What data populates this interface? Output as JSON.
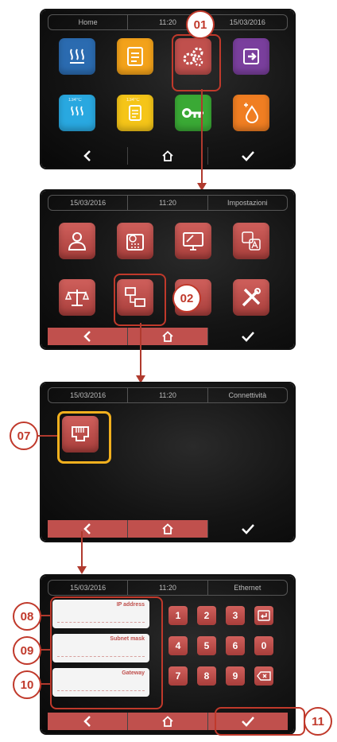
{
  "screen1": {
    "topbar": {
      "title": "Home",
      "time": "11:20",
      "date": "15/03/2016"
    },
    "tiles": [
      {
        "icon": "heating-icon",
        "color": "#2b6bb0",
        "label": ""
      },
      {
        "icon": "checklist-icon",
        "color": "#f3a21a",
        "label": ""
      },
      {
        "icon": "settings-gears-icon",
        "color": "#c0504d",
        "label": ""
      },
      {
        "icon": "exit-icon",
        "color": "#7a3f9d",
        "label": ""
      },
      {
        "icon": "sterilization-icon",
        "color": "#29a8e0",
        "label": "134°C"
      },
      {
        "icon": "program-icon",
        "color": "#f5c518",
        "label": "134°C"
      },
      {
        "icon": "key-icon",
        "color": "#3aa935",
        "label": ""
      },
      {
        "icon": "water-drop-icon",
        "color": "#f07e22",
        "label": ""
      }
    ],
    "badge": "01"
  },
  "screen2": {
    "topbar": {
      "date": "15/03/2016",
      "time": "11:20",
      "title": "Impostazioni"
    },
    "badge": "02"
  },
  "screen3": {
    "topbar": {
      "date": "15/03/2016",
      "time": "11:20",
      "title": "Connettività"
    },
    "badge": "07"
  },
  "screen4": {
    "topbar": {
      "date": "15/03/2016",
      "time": "11:20",
      "title": "Ethernet"
    },
    "fields": [
      {
        "label": "IP address",
        "badge": "08"
      },
      {
        "label": "Subnet mask",
        "badge": "09"
      },
      {
        "label": "Gateway",
        "badge": "10"
      }
    ],
    "keypad": [
      "1",
      "2",
      "3",
      "4",
      "5",
      "6",
      "0",
      "7",
      "8",
      "9"
    ],
    "confirm_badge": "11"
  },
  "colors": {
    "accent": "#c0504d",
    "badge": "#c0392b",
    "highlight_orange": "#f2b01e"
  }
}
